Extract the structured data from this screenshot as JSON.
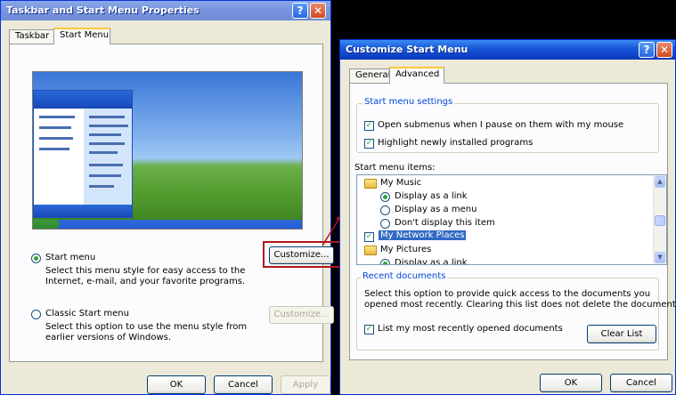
{
  "colors": {
    "xp_blue": "#0a49d1",
    "selection": "#316ac5",
    "highlight_box": "#b1151b"
  },
  "left_dialog": {
    "title": "Taskbar and Start Menu Properties",
    "tabs": [
      "Taskbar",
      "Start Menu"
    ],
    "start_menu_label": "Start menu",
    "start_menu_desc_1": "Select this menu style for easy access to the",
    "start_menu_desc_2": "Internet, e-mail, and your favorite programs.",
    "classic_label": "Classic Start menu",
    "classic_desc_1": "Select this option to use the menu style from",
    "classic_desc_2": "earlier versions of Windows.",
    "customize_1": "Customize...",
    "customize_2": "Customize...",
    "ok": "OK",
    "cancel": "Cancel",
    "apply": "Apply"
  },
  "right_dialog": {
    "title": "Customize Start Menu",
    "tabs": [
      "General",
      "Advanced"
    ],
    "settings_group": "Start menu settings",
    "opt_submenus": "Open submenus when I pause on them with my mouse",
    "opt_highlight": "Highlight newly installed programs",
    "items_label": "Start menu items:",
    "items": {
      "my_music": "My Music",
      "display_link": "Display as a link",
      "display_menu": "Display as a menu",
      "dont_display": "Don't display this item",
      "network_places": "My Network Places",
      "my_pictures": "My Pictures",
      "display_link_2": "Display as a link"
    },
    "recent_group": "Recent documents",
    "recent_desc_1": "Select this option to provide quick access to the documents you",
    "recent_desc_2": "opened most recently.  Clearing this list does not delete the documents.",
    "list_recent": "List my most recently opened documents",
    "clear_list": "Clear List",
    "ok": "OK",
    "cancel": "Cancel"
  }
}
